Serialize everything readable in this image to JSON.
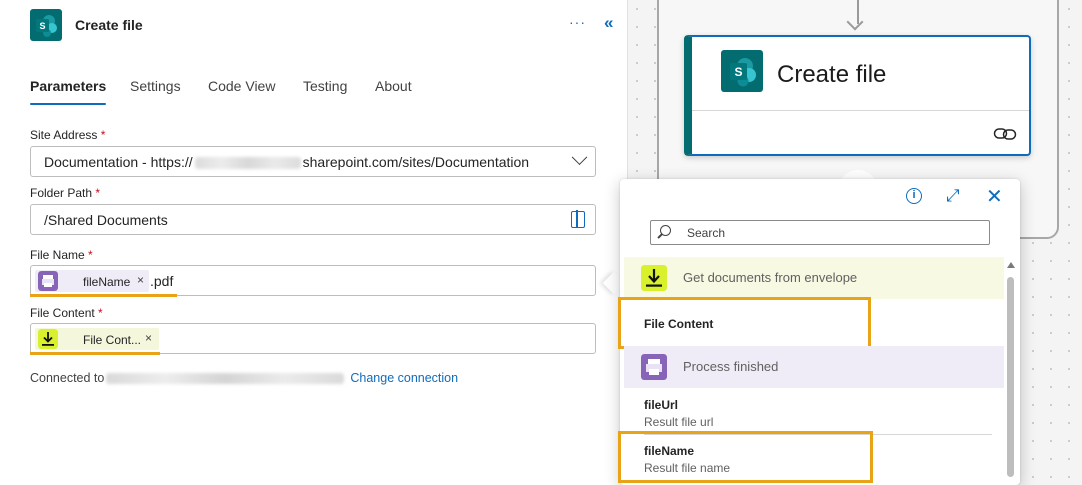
{
  "panel": {
    "title": "Create file",
    "more_label": "···",
    "collapse_label": "«",
    "tabs": [
      {
        "label": "Parameters",
        "active": true
      },
      {
        "label": "Settings",
        "active": false
      },
      {
        "label": "Code View",
        "active": false
      },
      {
        "label": "Testing",
        "active": false
      },
      {
        "label": "About",
        "active": false
      }
    ],
    "site_address": {
      "label": "Site Address",
      "required_mark": "*",
      "value_prefix": "Documentation - https://",
      "value_suffix": "sharepoint.com/sites/Documentation"
    },
    "folder_path": {
      "label": "Folder Path",
      "required_mark": "*",
      "value": "/Shared Documents"
    },
    "file_name": {
      "label": "File Name",
      "required_mark": "*",
      "token_label": "fileName",
      "token_remove": "×",
      "suffix": ".pdf"
    },
    "file_content": {
      "label": "File Content",
      "required_mark": "*",
      "token_label": "File Cont...",
      "token_remove": "×"
    },
    "connection": {
      "prefix": "Connected to",
      "change_label": "Change connection"
    }
  },
  "canvas": {
    "card_title": "Create file"
  },
  "popup": {
    "search_placeholder": "Search",
    "info_label": "i",
    "expand_label": "⤢",
    "close_label": "✕",
    "groups": [
      {
        "title": "Get documents from envelope",
        "items": [
          {
            "name": "File Content",
            "desc": ""
          }
        ]
      },
      {
        "title": "Process finished",
        "items": [
          {
            "name": "fileUrl",
            "desc": "Result file url"
          },
          {
            "name": "fileName",
            "desc": "Result file name"
          }
        ]
      }
    ]
  },
  "colors": {
    "sharepoint": "#036c70",
    "accent": "#0f6cbd",
    "highlight": "#e8a317",
    "docusign_yellow": "#d9f02c",
    "process_purple": "#8764b8"
  }
}
